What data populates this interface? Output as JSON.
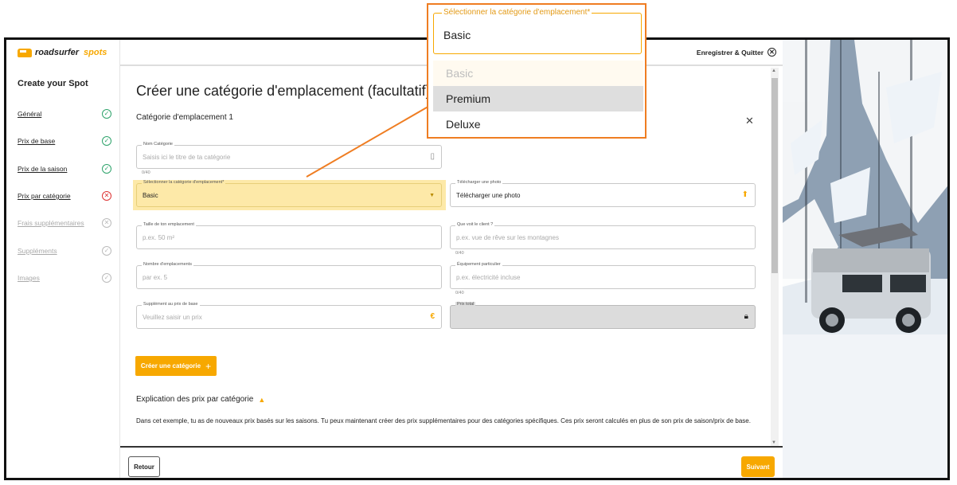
{
  "brand": {
    "name": "roadsurfer",
    "suffix": "spots"
  },
  "sidebar": {
    "title": "Create your Spot",
    "items": [
      {
        "label": "Général",
        "status": "ok"
      },
      {
        "label": "Prix de base",
        "status": "ok"
      },
      {
        "label": "Prix de la saison",
        "status": "ok"
      },
      {
        "label": "Prix par catégorie",
        "status": "error"
      },
      {
        "label": "Frais supplémentaires",
        "status": "error-dim"
      },
      {
        "label": "Suppléments",
        "status": "ok-dim"
      },
      {
        "label": "Images",
        "status": "ok-dim"
      }
    ]
  },
  "header": {
    "save_quit": "Enregistrer & Quitter"
  },
  "main": {
    "title": "Créer une catégorie d'emplacement (facultatif)",
    "category_title": "Catégorie d'emplacement 1",
    "fields": {
      "name": {
        "label": "Nom Catégorie",
        "placeholder": "Saisis ici le titre de ta catégorie",
        "counter": "0/40"
      },
      "select": {
        "label": "Sélectionner la catégorie d'emplacement*",
        "value": "Basic"
      },
      "photo": {
        "label": "Télécharger une photo",
        "value": "Télécharger une photo"
      },
      "size": {
        "label": "Taille de ton emplacement",
        "placeholder": "p.ex. 50 m²"
      },
      "view": {
        "label": "Que voit le client ?",
        "placeholder": "p.ex. vue de rêve sur les montagnes",
        "counter": "0/40"
      },
      "count": {
        "label": "Nombre d'emplacements",
        "placeholder": "par ex. 5"
      },
      "equipment": {
        "label": "Équipement particulier",
        "placeholder": "p.ex. électricité incluse",
        "counter": "0/40"
      },
      "surcharge": {
        "label": "Supplément au prix de base",
        "placeholder": "Veuillez saisir un prix"
      },
      "total": {
        "label": "Prix total",
        "value": ""
      }
    },
    "create_button": "Créer une catégorie",
    "explain_title": "Explication des prix par catégorie",
    "explain_text": "Dans cet exemple, tu as de nouveaux prix basés sur les saisons. Tu peux maintenant créer des prix supplémentaires pour des catégories spécifiques. Ces prix seront calculés en plus de son prix de saison/prix de base."
  },
  "footer": {
    "back": "Retour",
    "next": "Suivant"
  },
  "callout": {
    "label": "Sélectionner la catégorie d'emplacement*",
    "value": "Basic",
    "options": [
      "Basic",
      "Premium",
      "Deluxe"
    ]
  },
  "colors": {
    "accent": "#f7a800",
    "callout_border": "#ef7d22",
    "ok": "#2ea36b",
    "error": "#dd3333"
  }
}
